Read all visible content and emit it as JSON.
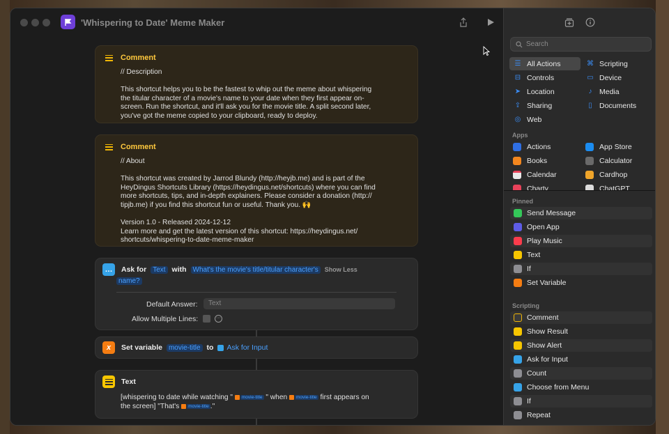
{
  "window": {
    "title": "'Whispering to Date' Meme Maker"
  },
  "comment1": {
    "label": "Comment",
    "lines": [
      "// Description",
      "",
      "This shortcut helps you to be the fastest to whip out the meme about whispering",
      "the titular character of a movie's name to your date when they first appear on-",
      "screen. Run the shortcut, and it'll ask you for the movie title. A split second later,",
      "you've got the meme copied to your clipboard, ready to deploy."
    ]
  },
  "comment2": {
    "label": "Comment",
    "lines": [
      "// About",
      "",
      "This shortcut was created by Jarrod Blundy (http://heyjb.me) and is part of the",
      "HeyDingus Shortcuts Library (https://heydingus.net/shortcuts) where you can find",
      "more shortcuts, tips, and in-depth explainers. Please consider a donation (http://",
      "tipjb.me) if you find this shortcut fun or useful. Thank you. 🙌",
      "",
      "Version 1.0 - Released 2024-12-12",
      "Learn more and get the latest version of this shortcut: https://heydingus.net/",
      "shortcuts/whispering-to-date-meme-maker"
    ]
  },
  "ask": {
    "prefix": "Ask for",
    "type": "Text",
    "with": "with",
    "prompt_line1": "What's the movie's title/titular character's",
    "prompt_line2": "name?",
    "show_less": "Show Less",
    "default_answer_label": "Default Answer:",
    "default_answer_placeholder": "Text",
    "multiline_label": "Allow Multiple Lines:"
  },
  "setvar": {
    "label": "Set variable",
    "variable": "movie-title",
    "to": "to",
    "value": "Ask for Input"
  },
  "text": {
    "label": "Text",
    "line1_a": "[whispering to date while watching \"",
    "token": "movie-title",
    "line1_b": "\" when",
    "line1_c": "first appears on",
    "line2_a": "the screen] \"That's",
    "line2_b": ".\""
  },
  "sidebar": {
    "search_placeholder": "Search",
    "categories": [
      {
        "label": "All Actions",
        "icon": "list-icon"
      },
      {
        "label": "Scripting",
        "icon": "scripting-icon"
      },
      {
        "label": "Controls",
        "icon": "controls-icon"
      },
      {
        "label": "Device",
        "icon": "device-icon"
      },
      {
        "label": "Location",
        "icon": "location-icon"
      },
      {
        "label": "Media",
        "icon": "music-note-icon"
      },
      {
        "label": "Sharing",
        "icon": "share-icon"
      },
      {
        "label": "Documents",
        "icon": "document-icon"
      },
      {
        "label": "Web",
        "icon": "compass-icon"
      }
    ],
    "apps_label": "Apps",
    "apps": [
      {
        "label": "Actions",
        "color": "#2f6fe4"
      },
      {
        "label": "App Store",
        "color": "#1b8cf0"
      },
      {
        "label": "Books",
        "color": "#f2861e"
      },
      {
        "label": "Calculator",
        "color": "#6a6a6a"
      },
      {
        "label": "Calendar",
        "color": "#e9e9e9"
      },
      {
        "label": "Cardhop",
        "color": "#f0a52a"
      },
      {
        "label": "Charty",
        "color": "#e8425a"
      },
      {
        "label": "ChatGPT",
        "color": "#dddddd"
      }
    ],
    "pinned_label": "Pinned",
    "pinned": [
      {
        "label": "Send Message",
        "color": "#34c759"
      },
      {
        "label": "Open App",
        "color": "#5e5ce6"
      },
      {
        "label": "Play Music",
        "color": "#fa3c4c"
      },
      {
        "label": "Text",
        "color": "#f7c600"
      },
      {
        "label": "If",
        "color": "#8e8e93"
      },
      {
        "label": "Set Variable",
        "color": "#f57d12"
      }
    ],
    "scripting_label": "Scripting",
    "scripting": [
      {
        "label": "Comment",
        "color": "#3a3a3a"
      },
      {
        "label": "Show Result",
        "color": "#f7c600"
      },
      {
        "label": "Show Alert",
        "color": "#f7c600"
      },
      {
        "label": "Ask for Input",
        "color": "#36a3e8"
      },
      {
        "label": "Count",
        "color": "#8e8e93"
      },
      {
        "label": "Choose from Menu",
        "color": "#36a3e8"
      },
      {
        "label": "If",
        "color": "#8e8e93"
      },
      {
        "label": "Repeat",
        "color": "#8e8e93"
      }
    ]
  }
}
